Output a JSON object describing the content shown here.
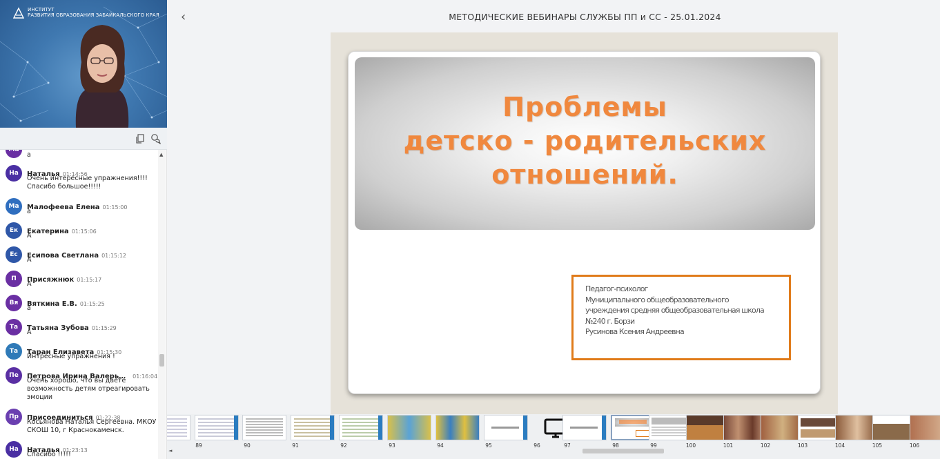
{
  "header": {
    "back_label": "‹",
    "title": "МЕТОДИЧЕСКИЕ ВЕБИНАРЫ СЛУЖБЫ ПП и СС - 25.01.2024"
  },
  "video": {
    "logo_line1": "ИНСТИТУТ",
    "logo_line2": "РАЗВИТИЯ ОБРАЗОВАНИЯ ЗАБАЙКАЛЬСКОГО КРАЯ"
  },
  "chat": {
    "messages": [
      {
        "initials": "Ма",
        "color": "#6a2fa3",
        "name": "",
        "time": "",
        "text": "а"
      },
      {
        "initials": "На",
        "color": "#4a2fa3",
        "name": "Наталья",
        "time": "01:14:56",
        "text": "Очень интересные упражнения!!!! Спасибо большое!!!!!"
      },
      {
        "initials": "Ма",
        "color": "#2f6ebf",
        "name": "Малофеева Елена",
        "time": "01:15:00",
        "text": "а"
      },
      {
        "initials": "Ек",
        "color": "#2f57a8",
        "name": "Екатерина",
        "time": "01:15:06",
        "text": "А"
      },
      {
        "initials": "Ес",
        "color": "#2f57a8",
        "name": "Есипова Светлана",
        "time": "01:15:12",
        "text": "А"
      },
      {
        "initials": "П",
        "color": "#6a2fa3",
        "name": "Присяжнюк",
        "time": "01:15:17",
        "text": "А"
      },
      {
        "initials": "Вя",
        "color": "#6a2fa3",
        "name": "Вяткина Е.В.",
        "time": "01:15:25",
        "text": "а"
      },
      {
        "initials": "Та",
        "color": "#6a2fa3",
        "name": "Татьяна Зубова",
        "time": "01:15:29",
        "text": "А"
      },
      {
        "initials": "Та",
        "color": "#2f7ab8",
        "name": "Таран Елизавета",
        "time": "01:15:30",
        "text": "Интресные упражнения !"
      },
      {
        "initials": "Пе",
        "color": "#5a2fa3",
        "name": "Петрова Ирина Валерь…",
        "time": "01:16:04",
        "text": "Очень хорошо, что вы даете возможность детям отреагировать эмоции"
      },
      {
        "initials": "Пр",
        "color": "#6a3fb0",
        "name": "Присоединиться",
        "time": "01:22:38",
        "text": "Косьянова Наталья Сергеевна. МКОУ СКОШ 10, г Краснокаменск."
      },
      {
        "initials": "На",
        "color": "#4a2fa3",
        "name": "Наталья",
        "time": "01:23:13",
        "text": "Спасибо !!!!!"
      }
    ]
  },
  "slide": {
    "title_lines": [
      "Проблемы",
      "детско - родительских",
      "отношений."
    ],
    "info_lines": [
      "Педагог-психолог",
      "Муниципального общеобразовательного",
      "учреждения средняя общеобразовательная школа",
      "№240 г. Борзи",
      "Русинова Ксения Андреевна"
    ]
  },
  "thumbnails": {
    "numbers": [
      "89",
      "90",
      "91",
      "92",
      "93",
      "94",
      "95",
      "96",
      "97",
      "98",
      "99",
      "100",
      "101",
      "102",
      "103",
      "104",
      "105",
      "106"
    ],
    "selected": "98"
  },
  "colors": {
    "accent_orange": "#f0883e",
    "box_border": "#e07b1a"
  }
}
